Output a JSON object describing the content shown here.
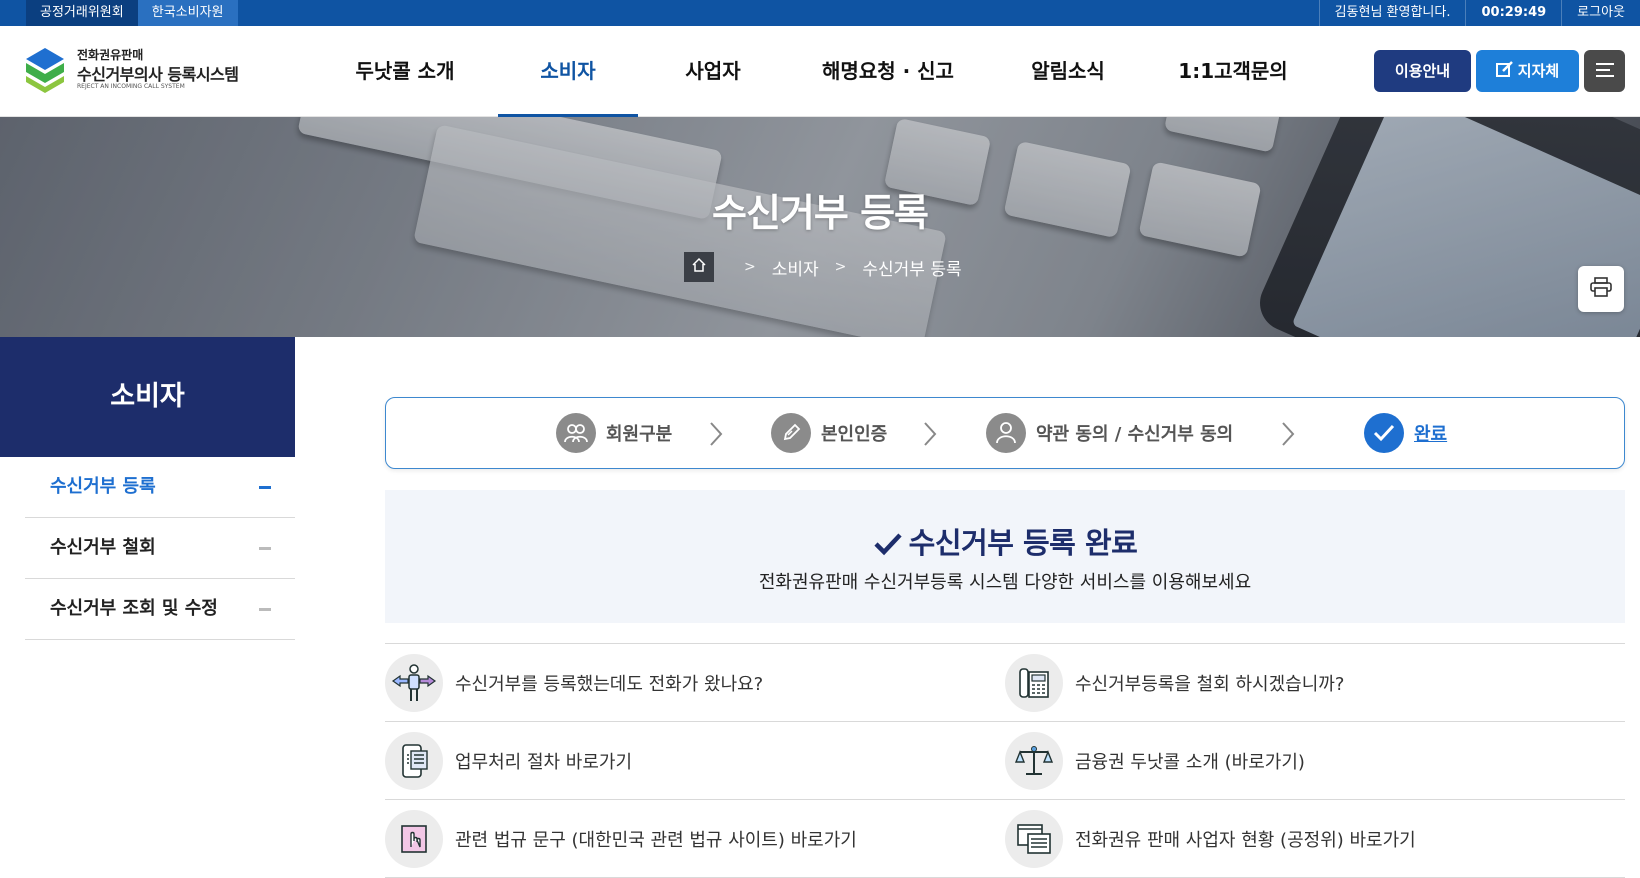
{
  "topbar": {
    "org1": "공정거래위원회",
    "org2": "한국소비자원",
    "welcome": "김동현님 환영합니다.",
    "timer": "00:29:49",
    "logout": "로그아웃"
  },
  "logo": {
    "line1": "전화권유판매",
    "line2": "수신거부의사 등록시스템",
    "line3": "REJECT AN INCOMING CALL SYSTEM"
  },
  "nav": [
    {
      "label": "두낫콜 소개",
      "active": false
    },
    {
      "label": "소비자",
      "active": true
    },
    {
      "label": "사업자",
      "active": false
    },
    {
      "label": "해명요청 · 신고",
      "active": false
    },
    {
      "label": "알림소식",
      "active": false
    },
    {
      "label": "1:1고객문의",
      "active": false
    }
  ],
  "header_buttons": {
    "guide": "이용안내",
    "local": "지자체",
    "menu_icon": "hamburger-icon"
  },
  "hero": {
    "title": "수신거부 등록",
    "breadcrumb": [
      "소비자",
      "수신거부 등록"
    ]
  },
  "sidebar": {
    "title": "소비자",
    "items": [
      {
        "label": "수신거부 등록",
        "active": true
      },
      {
        "label": "수신거부 철회",
        "active": false
      },
      {
        "label": "수신거부 조회 및 수정",
        "active": false
      }
    ]
  },
  "steps": [
    {
      "label": "회원구분",
      "icon": "users-icon",
      "done": false
    },
    {
      "label": "본인인증",
      "icon": "pencil-icon",
      "done": false
    },
    {
      "label": "약관 동의 / 수신거부 동의",
      "icon": "person-icon",
      "done": false
    },
    {
      "label": "완료",
      "icon": "check-icon",
      "done": true
    }
  ],
  "complete": {
    "title": "수신거부 등록 완료",
    "desc": "전화권유판매 수신거부등록 시스템 다양한 서비스를 이용해보세요"
  },
  "links": [
    {
      "label": "수신거부를 등록했는데도 전화가 왔나요?",
      "icon": "direction-person-icon"
    },
    {
      "label": "수신거부등록을 철회 하시겠습니까?",
      "icon": "telephone-icon"
    },
    {
      "label": "업무처리 절차 바로가기",
      "icon": "mobile-document-icon"
    },
    {
      "label": "금융권 두낫콜 소개 (바로가기)",
      "icon": "scales-icon"
    },
    {
      "label": "관련 법규 문구 (대한민국 관련 법규 사이트) 바로가기",
      "icon": "hand-pointer-icon"
    },
    {
      "label": "전화권유 판매 사업자 현황 (공정위) 바로가기",
      "icon": "documents-icon"
    }
  ],
  "colors": {
    "topbar": "#0f54a3",
    "navy": "#1d2d6b",
    "accent": "#1e6fd0",
    "step_inactive": "#8b8b8b"
  }
}
